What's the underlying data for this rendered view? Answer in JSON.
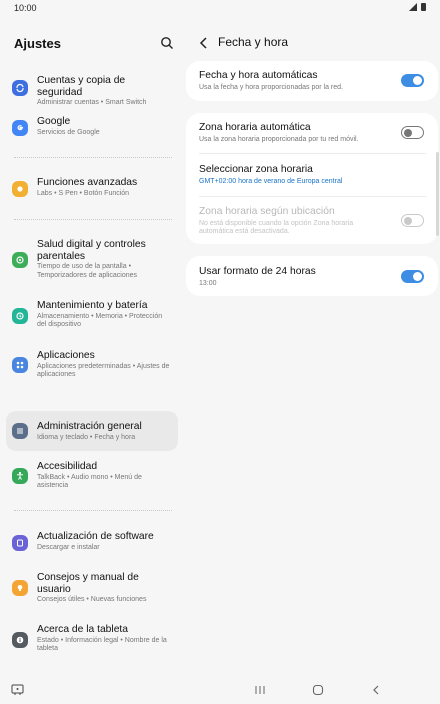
{
  "status": {
    "time": "10:00"
  },
  "left": {
    "title": "Ajustes",
    "items": [
      {
        "title": "Cuentas y copia de seguridad",
        "sub": "Administrar cuentas  •  Smart Switch",
        "icon": "sync-icon",
        "color": "#3d6fe0"
      },
      {
        "title": "Google",
        "sub": "Servicios de Google",
        "icon": "google-icon",
        "color": "#4285f4"
      },
      {
        "title": "Funciones avanzadas",
        "sub": "Labs  •  S Pen  •  Botón Función",
        "icon": "star-icon",
        "color": "#f1b033"
      },
      {
        "title": "Salud digital y controles parentales",
        "sub": "Tiempo de uso de la pantalla  •  Temporizadores de aplicaciones",
        "icon": "wellbeing-icon",
        "color": "#3dad5a"
      },
      {
        "title": "Mantenimiento y batería",
        "sub": "Almacenamiento  •  Memoria  •  Protección del dispositivo",
        "icon": "maintenance-icon",
        "color": "#22b596"
      },
      {
        "title": "Aplicaciones",
        "sub": "Aplicaciones predeterminadas  •  Ajustes de aplicaciones",
        "icon": "apps-icon",
        "color": "#4a86e0"
      },
      {
        "title": "Administración general",
        "sub": "Idioma y teclado  •  Fecha y hora",
        "icon": "sliders-icon",
        "color": "#5c6f8a"
      },
      {
        "title": "Accesibilidad",
        "sub": "TalkBack  •  Audio mono  •  Menú de asistencia",
        "icon": "accessibility-icon",
        "color": "#36a85a"
      },
      {
        "title": "Actualización de software",
        "sub": "Descargar e instalar",
        "icon": "update-icon",
        "color": "#6a63d6"
      },
      {
        "title": "Consejos y manual de usuario",
        "sub": "Consejos útiles  •  Nuevas funciones",
        "icon": "lightbulb-icon",
        "color": "#f3a433"
      },
      {
        "title": "Acerca de la tableta",
        "sub": "Estado  •  Información legal  •  Nombre de la tableta",
        "icon": "info-icon",
        "color": "#555a60"
      }
    ]
  },
  "right": {
    "title": "Fecha y hora",
    "rows": [
      {
        "title": "Fecha y hora automáticas",
        "sub": "Usa la fecha y hora proporcionadas por la red.",
        "toggle": "on"
      },
      {
        "title": "Zona horaria automática",
        "sub": "Usa la zona horaria proporcionada por tu red móvil.",
        "toggle": "off"
      },
      {
        "title": "Seleccionar zona horaria",
        "sub": "GMT+02:00 hora de verano de Europa central"
      },
      {
        "title": "Zona horaria según ubicación",
        "sub": "No está disponible cuando la opción Zona horaria automática está desactivada.",
        "toggle": "disabled"
      },
      {
        "title": "Usar formato de 24 horas",
        "sub": "13:00",
        "toggle": "on"
      }
    ]
  },
  "colors": {
    "accent": "#3e8de4",
    "link": "#1a73c7",
    "selected_bg": "#e9e9ea"
  }
}
